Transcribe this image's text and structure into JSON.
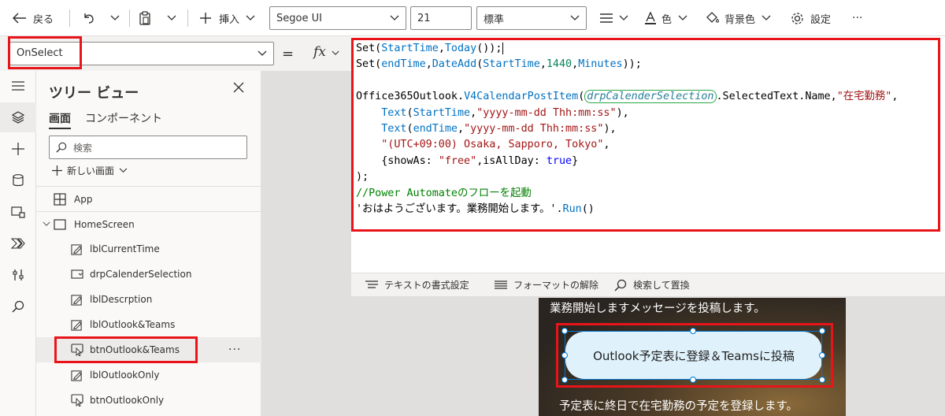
{
  "toolbar": {
    "back_label": "戻る",
    "insert_label": "挿入",
    "font_value": "Segoe UI",
    "size_value": "21",
    "weight_value": "標準",
    "color_label": "色",
    "bgcolor_label": "背景色",
    "settings_label": "設定",
    "more_label": "···"
  },
  "formula": {
    "property": "OnSelect",
    "equals": "=",
    "fx": "fx"
  },
  "tree": {
    "title": "ツリー ビュー",
    "tab_screens": "画面",
    "tab_components": "コンポーネント",
    "search_placeholder": "検索",
    "new_screen": "新しい画面",
    "items": [
      {
        "label": "App"
      },
      {
        "label": "HomeScreen"
      },
      {
        "label": "lblCurrentTime"
      },
      {
        "label": "drpCalenderSelection"
      },
      {
        "label": "lblDescrption"
      },
      {
        "label": "lblOutlook&Teams"
      },
      {
        "label": "btnOutlook&Teams"
      },
      {
        "label": "lblOutlookOnly"
      },
      {
        "label": "btnOutlookOnly"
      }
    ],
    "more": "···"
  },
  "code": {
    "l1a": "Set(",
    "l1b": "StartTime",
    "l1c": ",",
    "l1d": "Today",
    "l1e": "());",
    "l2a": "Set(",
    "l2b": "endTime",
    "l2c": ",",
    "l2d": "DateAdd",
    "l2e": "(",
    "l2f": "StartTime",
    "l2g": ",",
    "l2h": "1440",
    "l2i": ",",
    "l2j": "Minutes",
    "l2k": "));",
    "l4a": "Office365Outlook.",
    "l4b": "V4CalendarPostItem",
    "l4c": "(",
    "l4d": "drpCalenderSelection",
    "l4e": ".SelectedText.Name,",
    "l4f": "\"在宅勤務\"",
    "l4g": ",",
    "l5a": "    ",
    "l5b": "Text",
    "l5c": "(",
    "l5d": "StartTime",
    "l5e": ",",
    "l5f": "\"yyyy-mm-dd Thh:mm:ss\"",
    "l5g": "),",
    "l6a": "    ",
    "l6b": "Text",
    "l6c": "(",
    "l6d": "endTime",
    "l6e": ",",
    "l6f": "\"yyyy-mm-dd Thh:mm:ss\"",
    "l6g": "),",
    "l7a": "    ",
    "l7b": "\"(UTC+09:00) Osaka, Sapporo, Tokyo\"",
    "l7c": ",",
    "l8a": "    {showAs: ",
    "l8b": "\"free\"",
    "l8c": ",isAllDay: ",
    "l8d": "true",
    "l8e": "}",
    "l9": ");",
    "l10": "//Power Automateのフローを起動",
    "l11a": "'おはようございます。業務開始します。'.",
    "l11b": "Run",
    "l11c": "()"
  },
  "code_footer": {
    "format_text": "テキストの書式設定",
    "remove_format": "フォーマットの解除",
    "find_replace": "検索して置換"
  },
  "preview": {
    "text_top": "業務開始しますメッセージを投稿します。",
    "button_label": "Outlook予定表に登録＆Teamsに投稿",
    "text_bottom": "予定表に終日で在宅勤務の予定を登録します。"
  },
  "colors": {
    "highlight": "#e8141a",
    "selection": "#0078d4"
  }
}
